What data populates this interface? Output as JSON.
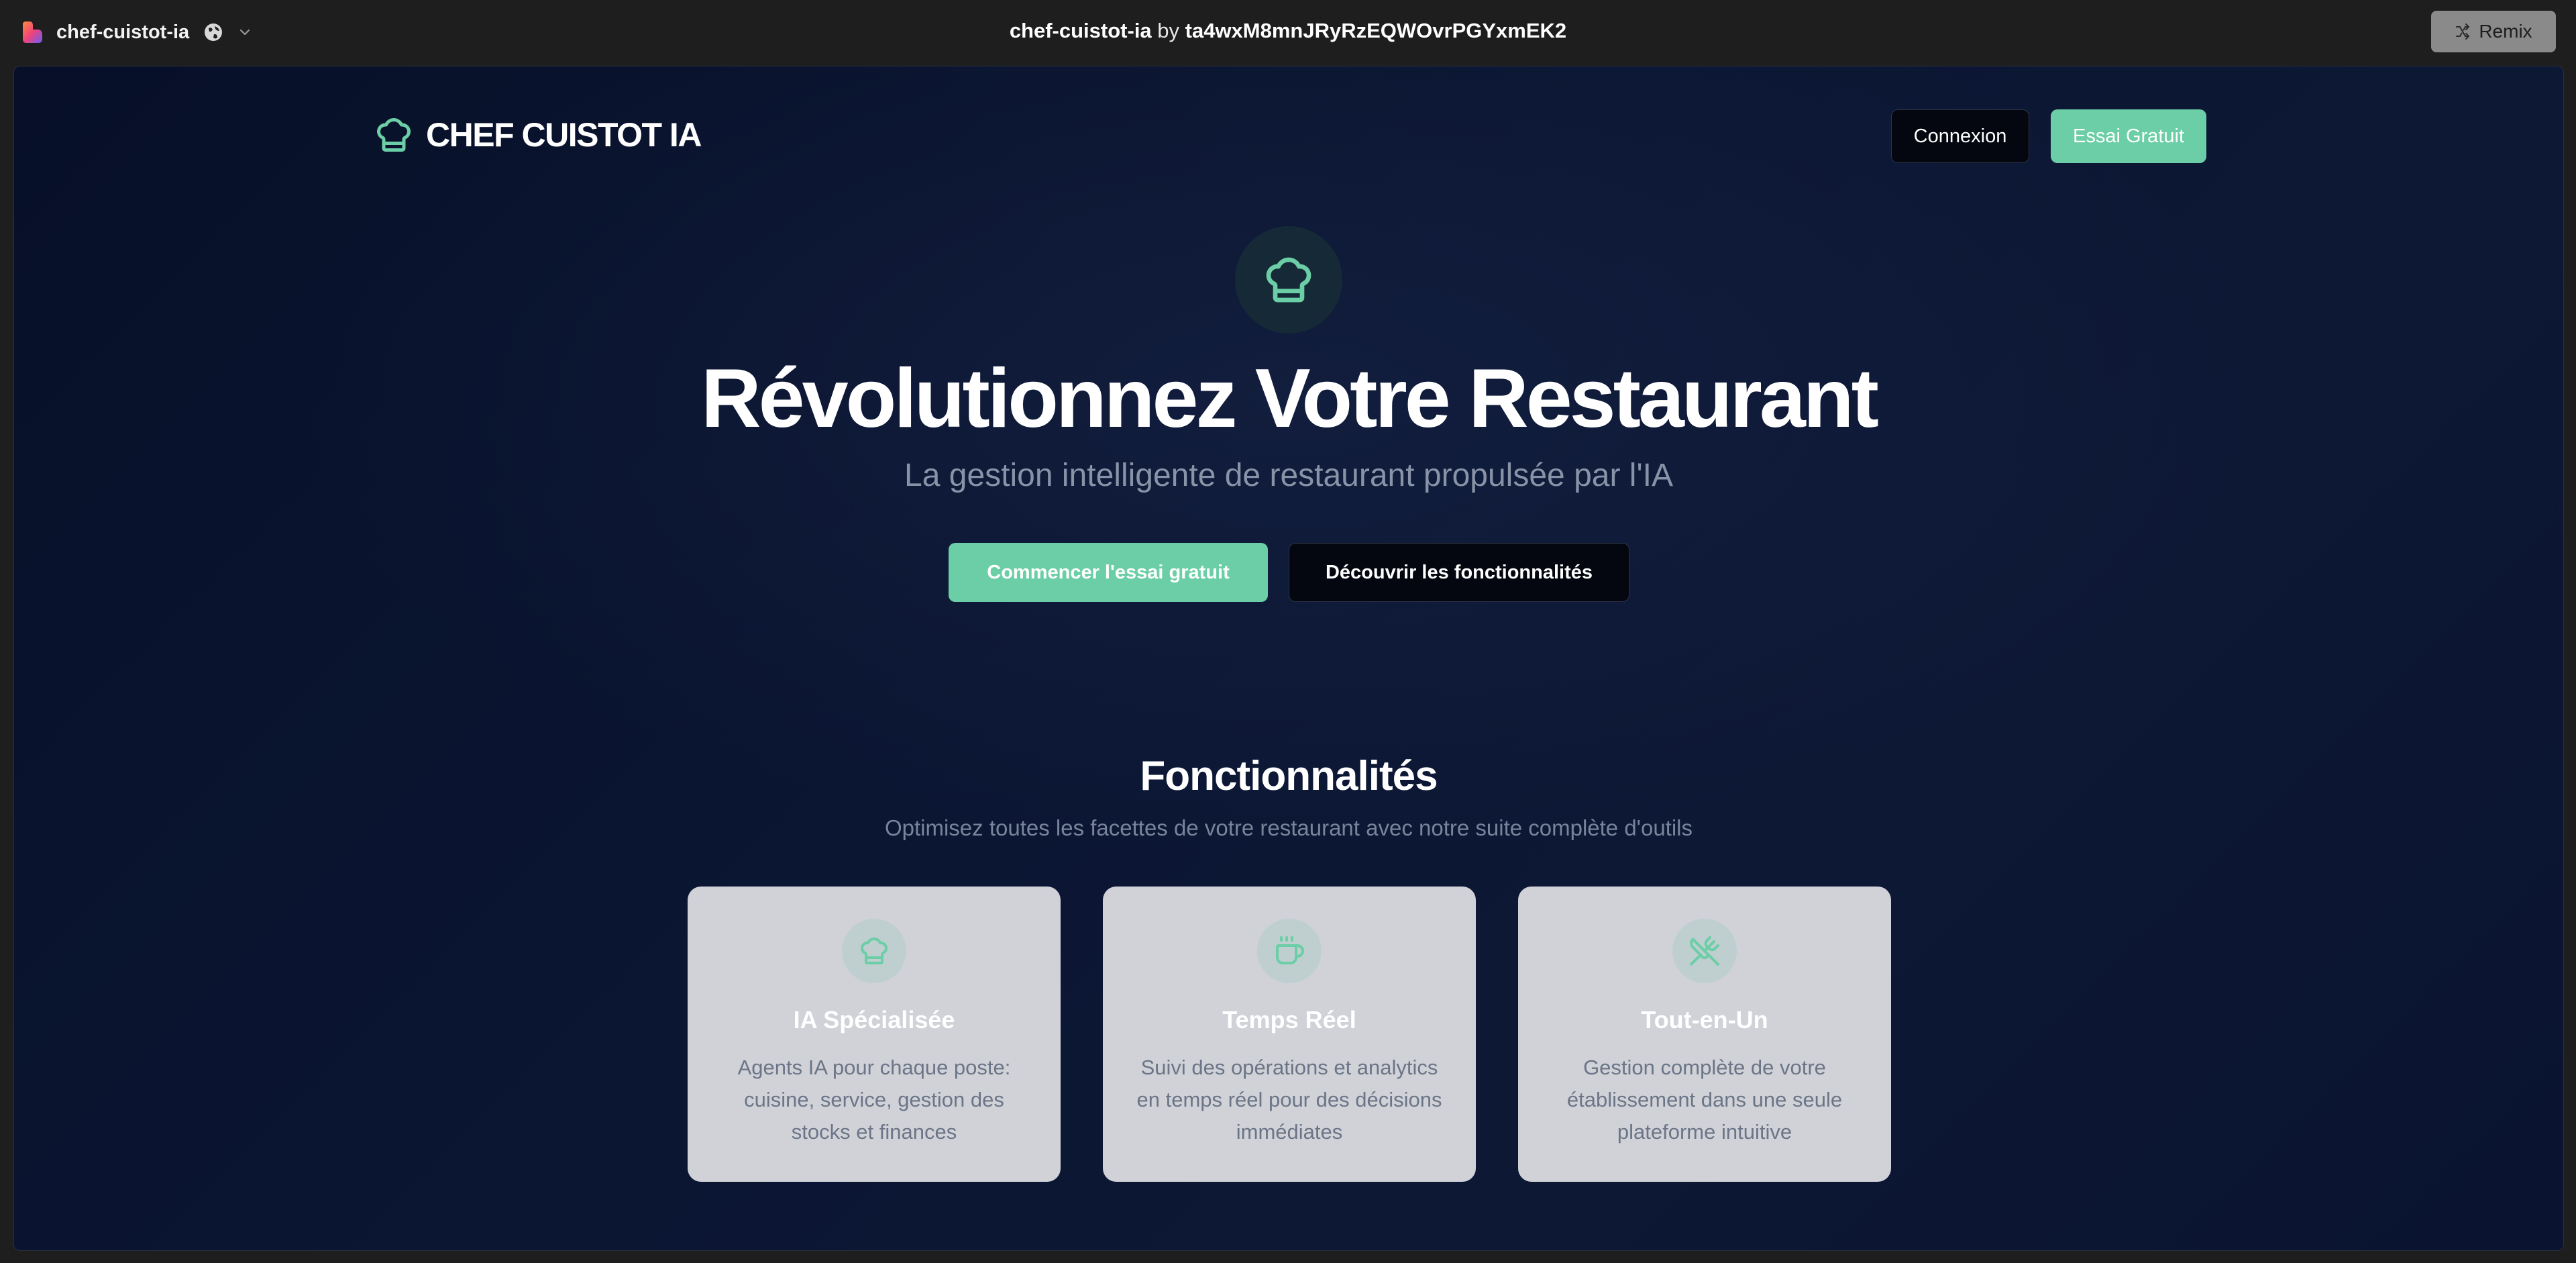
{
  "chrome": {
    "app_name": "chef-cuistot-ia",
    "window_title_app": "chef-cuistot-ia",
    "window_title_by": " by ",
    "window_title_user": "ta4wxM8mnJRyRzEQWOvrPGYxmEK2",
    "remix_label": "Remix"
  },
  "nav": {
    "brand": "CHEF CUISTOT IA",
    "login_label": "Connexion",
    "trial_label": "Essai Gratuit"
  },
  "hero": {
    "title": "Révolutionnez Votre Restaurant",
    "subtitle": "La gestion intelligente de restaurant propulsée par l'IA",
    "cta_primary": "Commencer l'essai gratuit",
    "cta_secondary": "Découvrir les fonctionnalités"
  },
  "features": {
    "title": "Fonctionnalités",
    "subtitle": "Optimisez toutes les facettes de votre restaurant avec notre suite complète d'outils",
    "cards": [
      {
        "icon": "chef-hat-icon",
        "title": "IA Spécialisée",
        "description": "Agents IA pour chaque poste: cuisine, service, gestion des stocks et finances"
      },
      {
        "icon": "coffee-icon",
        "title": "Temps Réel",
        "description": "Suivi des opérations et analytics en temps réel pour des décisions immédiates"
      },
      {
        "icon": "utensils-crossed-icon",
        "title": "Tout-en-Un",
        "description": "Gestion complète de votre établissement dans une seule plateforme intuitive"
      }
    ]
  },
  "colors": {
    "accent": "#6bcea6",
    "page_bg": "#0b1633",
    "card_bg": "#d0d2d8"
  }
}
